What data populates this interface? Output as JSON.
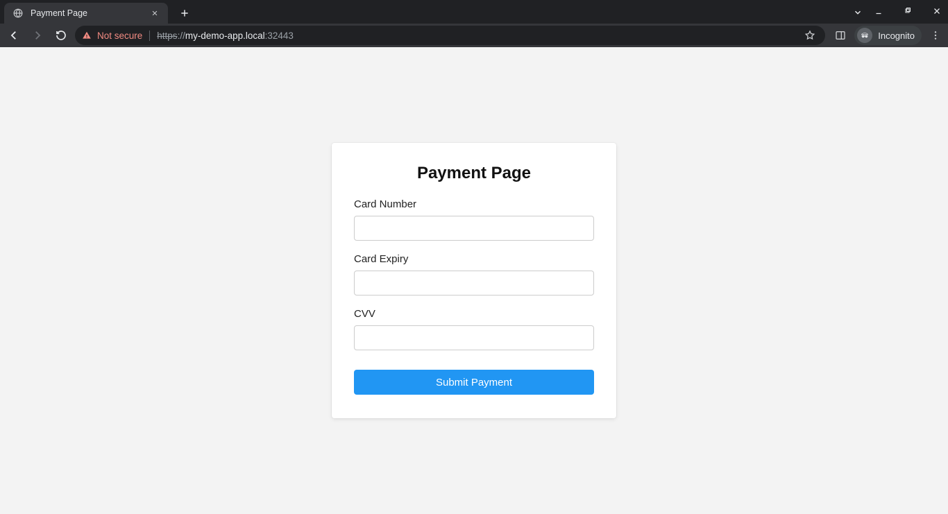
{
  "browser": {
    "tab": {
      "title": "Payment Page"
    },
    "security_label": "Not secure",
    "url": {
      "scheme": "https",
      "separator": "://",
      "host": "my-demo-app.local",
      "port_sep": ":",
      "port": "32443"
    },
    "incognito_label": "Incognito"
  },
  "page": {
    "heading": "Payment Page",
    "fields": {
      "card_number": {
        "label": "Card Number",
        "value": ""
      },
      "card_expiry": {
        "label": "Card Expiry",
        "value": ""
      },
      "cvv": {
        "label": "CVV",
        "value": ""
      }
    },
    "submit_label": "Submit Payment"
  }
}
